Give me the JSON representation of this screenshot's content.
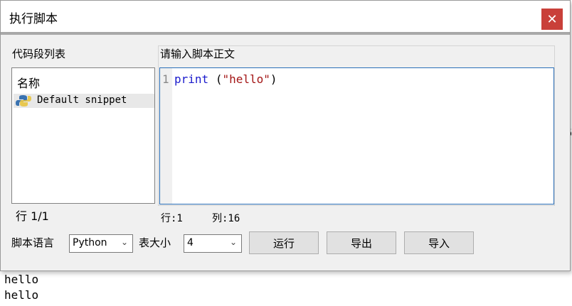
{
  "dialog": {
    "title": "执行脚本",
    "close_glyph": "✕"
  },
  "snippet_list": {
    "group_title": "代码段列表",
    "column_header": "名称",
    "items": [
      {
        "icon": "python-icon",
        "label": "Default snippet"
      }
    ],
    "row_indicator": "行 1/1"
  },
  "editor": {
    "group_title": "请输入脚本正文",
    "line_number": "1",
    "code_keyword": "print",
    "code_space": " ",
    "code_open": "(",
    "code_string": "\"hello\"",
    "code_close": ")",
    "status_line": "行:1",
    "status_col": "列:16"
  },
  "footer": {
    "lang_label": "脚本语言",
    "lang_value": "Python",
    "tab_label": "表大小",
    "tab_value": "4",
    "run_label": "运行",
    "export_label": "导出",
    "import_label": "导入"
  },
  "background": {
    "output_lines": [
      "hello",
      "hello"
    ],
    "side_fragments": [
      "--",
      "6",
      "g-",
      "--"
    ]
  },
  "colors": {
    "close_button": "#c9403a",
    "editor_border": "#2a6fb8",
    "keyword": "#1a1acc",
    "string": "#a31515"
  }
}
